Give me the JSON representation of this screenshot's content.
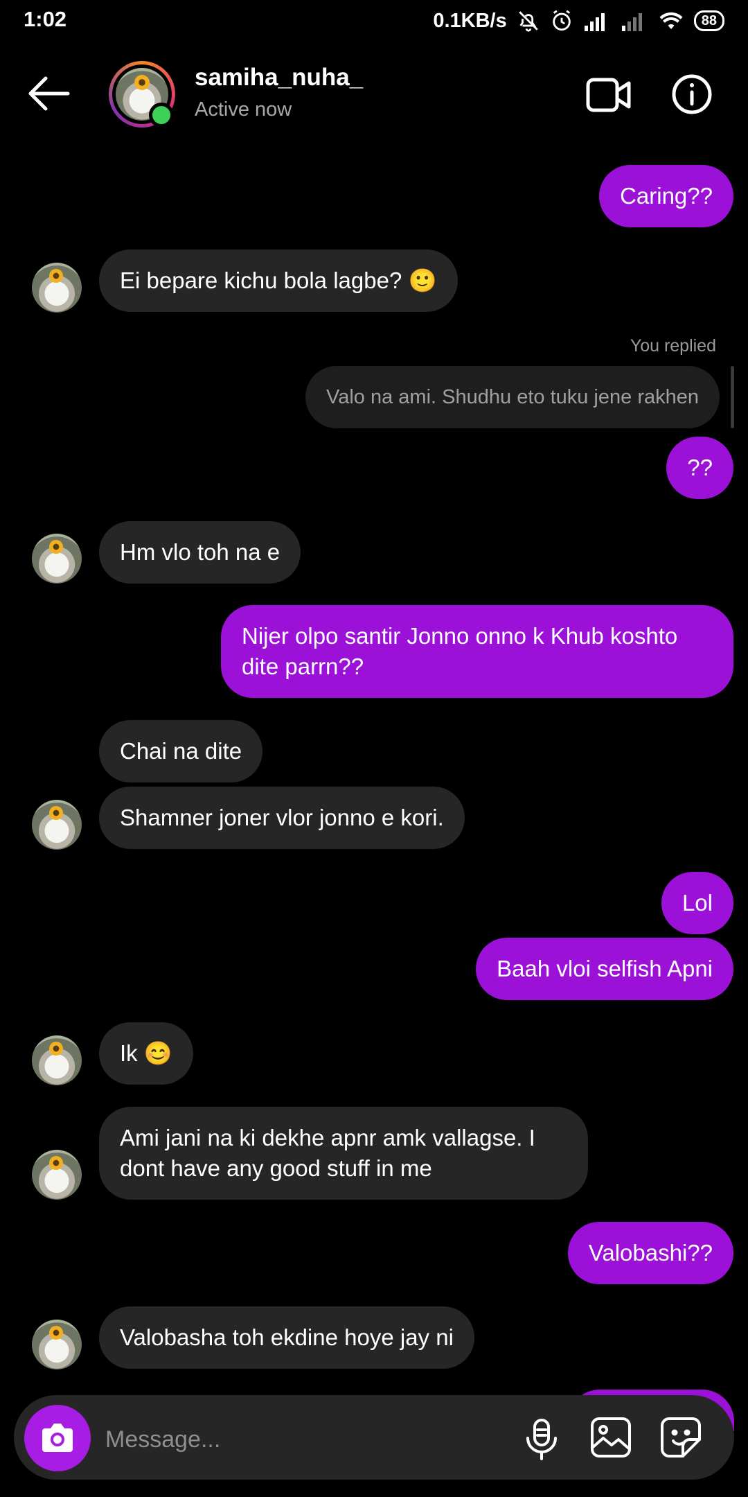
{
  "status_bar": {
    "time": "1:02",
    "network_speed": "0.1KB/s",
    "battery": "88"
  },
  "header": {
    "username": "samiha_nuha_",
    "status": "Active now",
    "icons": [
      "back-arrow-icon",
      "video-call-icon",
      "info-icon"
    ]
  },
  "thread": {
    "you_replied_label": "You replied",
    "messages": [
      {
        "from": "me",
        "text": "Caring??"
      },
      {
        "from": "them",
        "text": "Ei bepare kichu bola lagbe? 🙂"
      },
      {
        "from": "me",
        "quoted": true,
        "text": "Valo na ami. Shudhu eto tuku jene rakhen"
      },
      {
        "from": "me",
        "text": "??"
      },
      {
        "from": "them",
        "text": "Hm vlo toh na e"
      },
      {
        "from": "me",
        "text": "Nijer olpo santir Jonno onno k Khub koshto dite parrn??"
      },
      {
        "from": "them",
        "text": "Chai na dite"
      },
      {
        "from": "them",
        "text": "Shamner joner vlor jonno e kori."
      },
      {
        "from": "me",
        "text": "Lol"
      },
      {
        "from": "me",
        "text": "Baah vloi selfish Apni"
      },
      {
        "from": "them",
        "text": "Ik 😊"
      },
      {
        "from": "them",
        "text": "Ami jani na ki dekhe apnr amk vallagse. I dont have any good stuff in me"
      },
      {
        "from": "me",
        "text": "Valobashi??"
      },
      {
        "from": "them",
        "text": "Valobasha toh ekdine hoye jay ni"
      }
    ]
  },
  "composer": {
    "placeholder": "Message...",
    "icons": [
      "camera-icon",
      "microphone-icon",
      "gallery-icon",
      "sticker-icon"
    ]
  },
  "colors": {
    "background": "#000000",
    "outgoing_bubble": "#9b11d8",
    "incoming_bubble": "#262626",
    "camera_button": "#a71de3",
    "online_dot": "#3ed159"
  }
}
